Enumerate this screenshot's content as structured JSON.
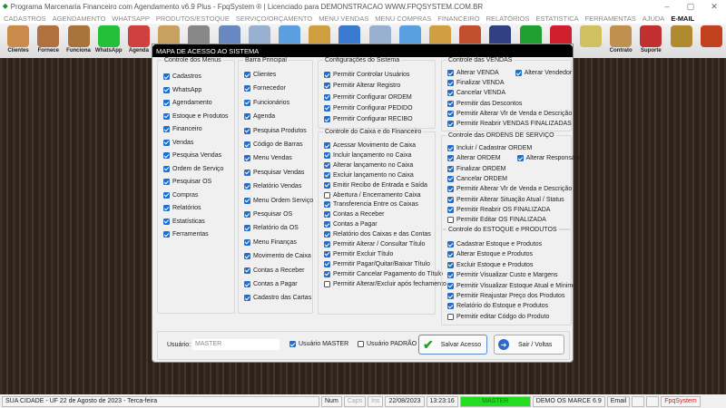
{
  "window": {
    "title": "Programa Marcenaria Financeiro com Agendamento v6.9 Plus - FpqSystem ® | Licenciado para  DEMONSTRACAO WWW.FPQSYSTEM.COM.BR",
    "minimize": "–",
    "maximize": "▢",
    "close": "✕"
  },
  "menu": [
    "CADASTROS",
    "AGENDAMENTO",
    "WHATSAPP",
    "PRODUTOS/ESTOQUE",
    "SERVIÇO/ORÇAMENTO",
    "MENU VENDAS",
    "MENU COMPRAS",
    "FINANCEIRO",
    "RELATÓRIOS",
    "ESTATISTICA",
    "FERRAMENTAS",
    "AJUDA",
    "E-MAIL"
  ],
  "toolbar": [
    {
      "label": "Clientes",
      "color": "#c98a4a"
    },
    {
      "label": "Fornece",
      "color": "#b07040"
    },
    {
      "label": "Funciona",
      "color": "#a8743c"
    },
    {
      "label": "WhatsApp",
      "color": "#25c03a"
    },
    {
      "label": "Agenda",
      "color": "#d04040"
    },
    {
      "label": "",
      "color": "#c8a060"
    },
    {
      "label": "",
      "color": "#888"
    },
    {
      "label": "",
      "color": "#6a88c0"
    },
    {
      "label": "",
      "color": "#9ab0d0"
    },
    {
      "label": "",
      "color": "#5aa0e0"
    },
    {
      "label": "",
      "color": "#d0a040"
    },
    {
      "label": "",
      "color": "#3a7ad0"
    },
    {
      "label": "",
      "color": "#9ab0d0"
    },
    {
      "label": "",
      "color": "#5aa0e0"
    },
    {
      "label": "",
      "color": "#d0a040"
    },
    {
      "label": "",
      "color": "#c05030"
    },
    {
      "label": "",
      "color": "#304080"
    },
    {
      "label": "",
      "color": "#20a030"
    },
    {
      "label": "",
      "color": "#d02030"
    },
    {
      "label": "",
      "color": "#d0c060"
    },
    {
      "label": "Contrato",
      "color": "#c09050"
    },
    {
      "label": "Suporte",
      "color": "#c03030"
    },
    {
      "label": "",
      "color": "#b08a30"
    },
    {
      "label": "",
      "color": "#c04020"
    }
  ],
  "dialog": {
    "title": "MAPA DE ACESSO AO SISTEMA",
    "groups": [
      {
        "title": "Controle dos Menus",
        "rows": [
          [
            [
              "Cadastros",
              1
            ]
          ],
          [
            [
              "WhatsApp",
              1
            ]
          ],
          [
            [
              "Agendamento",
              1
            ]
          ],
          [
            [
              "Estoque e Produtos",
              1
            ]
          ],
          [
            [
              "Financeiro",
              1
            ]
          ],
          [
            [
              "Vendas",
              1
            ]
          ],
          [
            [
              "Pesquisa Vendas",
              1
            ]
          ],
          [
            [
              "Ordem de Serviço",
              1
            ]
          ],
          [
            [
              "Pesquisar OS",
              1
            ]
          ],
          [
            [
              "Compras",
              1
            ]
          ],
          [
            [
              "Relatórios",
              1
            ]
          ],
          [
            [
              "Estatísticas",
              1
            ]
          ],
          [
            [
              "Ferramentas",
              1
            ]
          ]
        ]
      },
      {
        "title": "Barra Principal",
        "rows": [
          [
            [
              "Clientes",
              1
            ]
          ],
          [
            [
              "Fornecedor",
              1
            ]
          ],
          [
            [
              "Funcionários",
              1
            ]
          ],
          [
            [
              "Agenda",
              1
            ]
          ],
          [
            [
              "Pesquisa Produtos",
              1
            ]
          ],
          [
            [
              "Código de Barras",
              1
            ]
          ],
          [
            [
              "Menu Vendas",
              1
            ]
          ],
          [
            [
              "Pesquisar Vendas",
              1
            ]
          ],
          [
            [
              "Relatório Vendas",
              1
            ]
          ],
          [
            [
              "Menu Ordem Serviço",
              1
            ]
          ],
          [
            [
              "Pesquisar OS",
              1
            ]
          ],
          [
            [
              "Relatório da OS",
              1
            ]
          ],
          [
            [
              "Menu Finanças",
              1
            ]
          ],
          [
            [
              "Movimento de Caixa",
              1
            ]
          ],
          [
            [
              "Contas a Receber",
              1
            ]
          ],
          [
            [
              "Contas a Pagar",
              1
            ]
          ],
          [
            [
              "Cadastro das Cartas",
              1
            ]
          ]
        ]
      },
      {
        "title": "Configurações do Sistema",
        "rows": [
          [
            [
              "Permitir Controlar Usuários",
              1
            ]
          ],
          [
            [
              "Permitir Alterar Registro",
              1
            ]
          ],
          [
            [
              "Permitir Configurar ORDEM",
              1
            ]
          ],
          [
            [
              "Permitir Configurar PEDIDO",
              1
            ]
          ],
          [
            [
              "Permitir Configurar RECIBO",
              1
            ]
          ]
        ]
      },
      {
        "title": "Controle do Caixa e do Financeiro",
        "rows": [
          [
            [
              "Acessar Movimento de Caixa",
              1
            ]
          ],
          [
            [
              "Incluir lançamento no Caixa",
              1
            ]
          ],
          [
            [
              "Alterar lançamento no Caixa",
              1
            ]
          ],
          [
            [
              "Excluir lançamento no Caixa",
              1
            ]
          ],
          [
            [
              "Emitir Recibo de Entrada e Saída",
              1
            ]
          ],
          [
            [
              "Abertura / Encerramento Caixa",
              0
            ]
          ],
          [
            [
              "Transferencia Entre os Caixas",
              1
            ]
          ],
          [
            [
              "Contas a Receber",
              1
            ]
          ],
          [
            [
              "Contas a Pagar",
              1
            ]
          ],
          [
            [
              "Relatório dos Caixas e das Contas",
              1
            ]
          ],
          [
            [
              "Permitir Alterar / Consultar Título",
              1
            ]
          ],
          [
            [
              "Permitir Excluir Título",
              1
            ]
          ],
          [
            [
              "Permitir Pagar/Quitar/Baixar Título",
              1
            ]
          ],
          [
            [
              "Permitir Cancelar Pagamento do Título",
              1
            ]
          ],
          [
            [
              "Permitir Alterar/Excluir após fechamento",
              0
            ]
          ]
        ]
      },
      {
        "title": "Controle das VENDAS",
        "rows": [
          [
            [
              "Alterar VENDA",
              1
            ],
            [
              "Alterar Vendedor",
              1
            ]
          ],
          [
            [
              "Finalizar VENDA",
              1
            ]
          ],
          [
            [
              "Cancelar VENDA",
              1
            ]
          ],
          [
            [
              "Permitir das Descontos",
              1
            ]
          ],
          [
            [
              "Permitir Alterar Vlr de Venda e Descrição",
              1
            ]
          ],
          [
            [
              "Permitir Reabrir VENDAS FINALIZADAS",
              1
            ]
          ]
        ]
      },
      {
        "title": "Controle das ORDENS DE SERVIÇO",
        "rows": [
          [
            [
              "Incluir / Cadastrar ORDEM",
              1
            ]
          ],
          [
            [
              "Alterar ORDEM",
              1
            ],
            [
              "Alterar Responsável",
              1
            ]
          ],
          [
            [
              "Finalizar ORDEM",
              1
            ]
          ],
          [
            [
              "Cancelar ORDEM",
              1
            ]
          ],
          [
            [
              "Permitir Alterar Vlr de Venda e Descrição",
              1
            ]
          ],
          [
            [
              "Permitir Alterar Situação Atual / Status",
              1
            ]
          ],
          [
            [
              "Permitir Reabrir OS FINALIZADA",
              1
            ]
          ],
          [
            [
              "Permitir Editar OS FINALIZADA",
              0
            ]
          ]
        ]
      },
      {
        "title": "Controle do ESTOQUE e PRODUTOS",
        "rows": [
          [
            [
              "Cadastrar Estoque e Produtos",
              1
            ]
          ],
          [
            [
              "Alterar Estoque e Produtos",
              1
            ]
          ],
          [
            [
              "Excluir Estoque e Produtos",
              1
            ]
          ],
          [
            [
              "Permitir Visualizar Custo e Margens",
              1
            ]
          ],
          [
            [
              "Permitir Visualizar Estoque Atual e Mínimo",
              1
            ]
          ],
          [
            [
              "Permitir Reajustar Preço dos Produtos",
              1
            ]
          ],
          [
            [
              "Relatório do Estoque e Produtos",
              1
            ]
          ],
          [
            [
              "Permitir editar Códgo do Produto",
              0
            ]
          ]
        ]
      }
    ],
    "user_label": "Usuário:",
    "user_value": "MASTER",
    "master_label": "Usuário MASTER",
    "master_checked": true,
    "padrao_label": "Usuário PADRÃO",
    "padrao_checked": false,
    "save_label": "Salvar Acesso",
    "exit_label": "Sair / Voltas"
  },
  "status": {
    "location": "SUA CIDADE - UF 22 de Agosto de 2023 - Terca-feira",
    "num": "Num",
    "caps": "Caps",
    "ins": "Ins",
    "date": "22/08/2023",
    "time": "13:23:16",
    "user": "MASTER",
    "version": "DEMO OS MARCE 6.9",
    "email": "Email",
    "brand": "FpqSystem"
  }
}
